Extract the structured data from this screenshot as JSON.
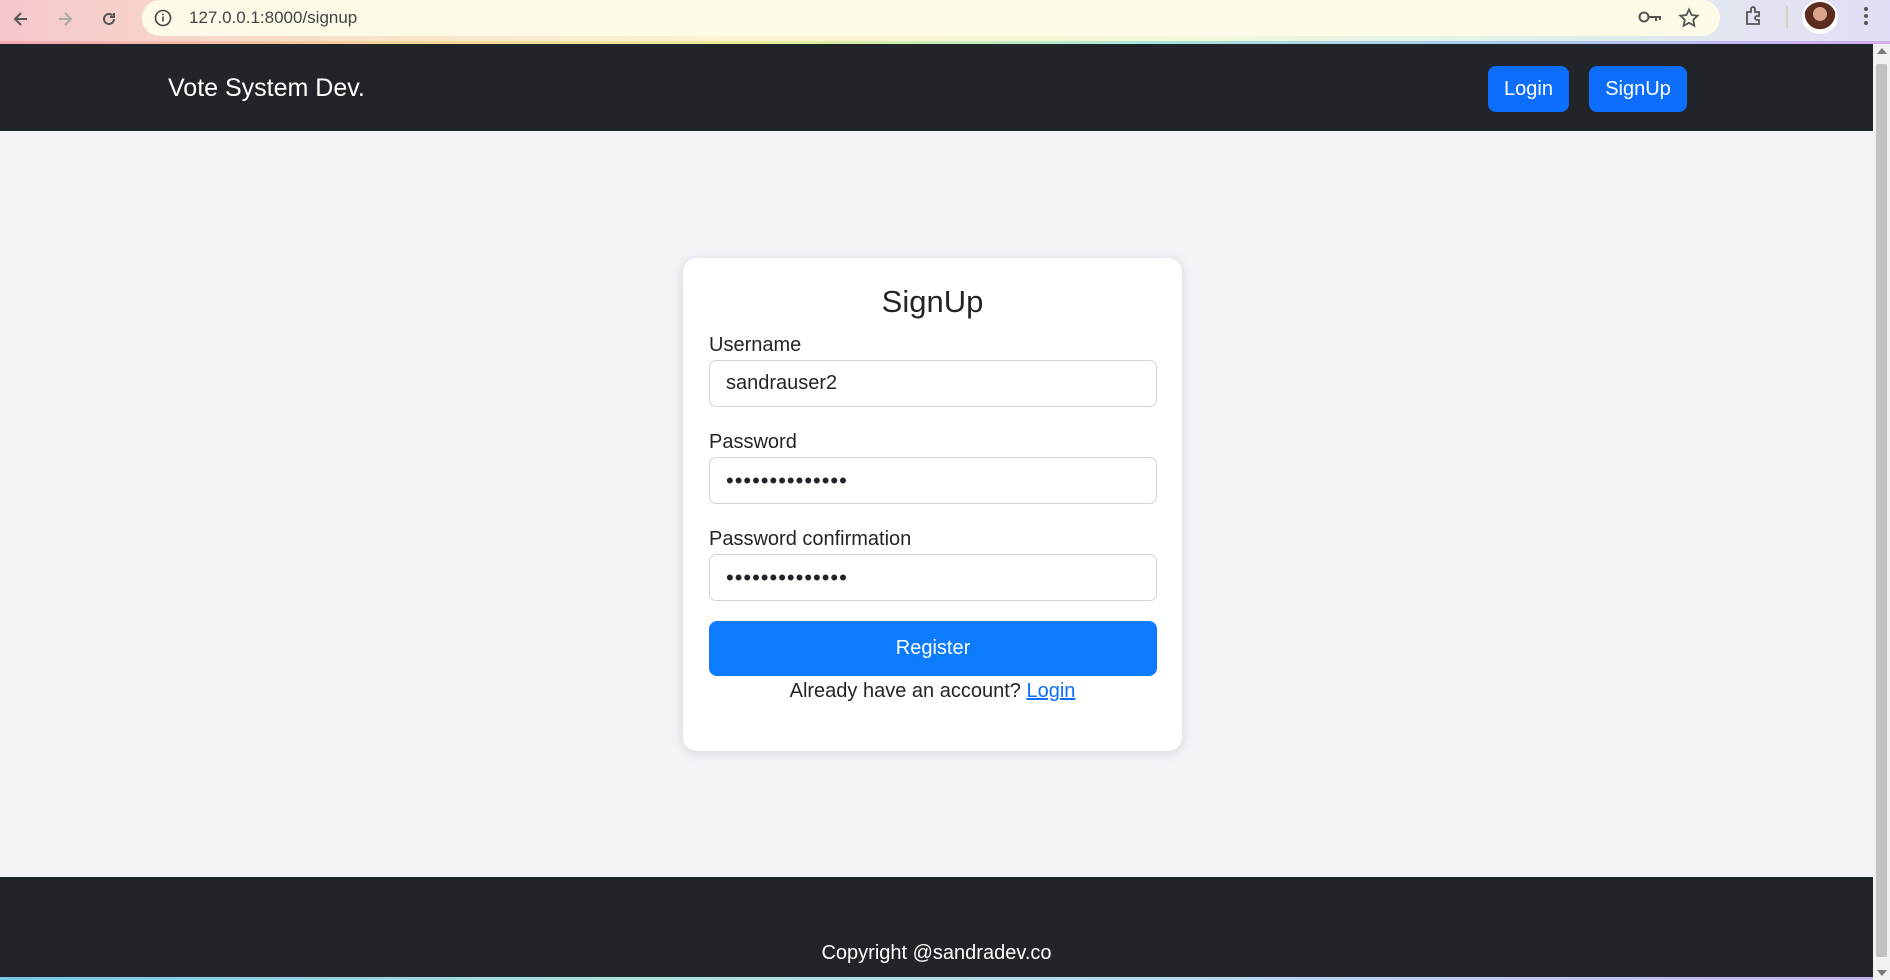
{
  "browser": {
    "url": "127.0.0.1:8000/signup"
  },
  "navbar": {
    "brand": "Vote System Dev.",
    "login_label": "Login",
    "signup_label": "SignUp"
  },
  "form": {
    "title": "SignUp",
    "username_label": "Username",
    "username_value": "sandrauser2",
    "password_label": "Password",
    "password_value": "••••••••••••••",
    "confirm_label": "Password confirmation",
    "confirm_value": "••••••••••••••",
    "register_label": "Register",
    "already_text": "Already have an account?",
    "login_link": "Login"
  },
  "footer": {
    "copyright": "Copyright @sandradev.co"
  },
  "colors": {
    "primary": "#0d6efd",
    "dark": "#212529",
    "background": "#f3f3f8"
  }
}
